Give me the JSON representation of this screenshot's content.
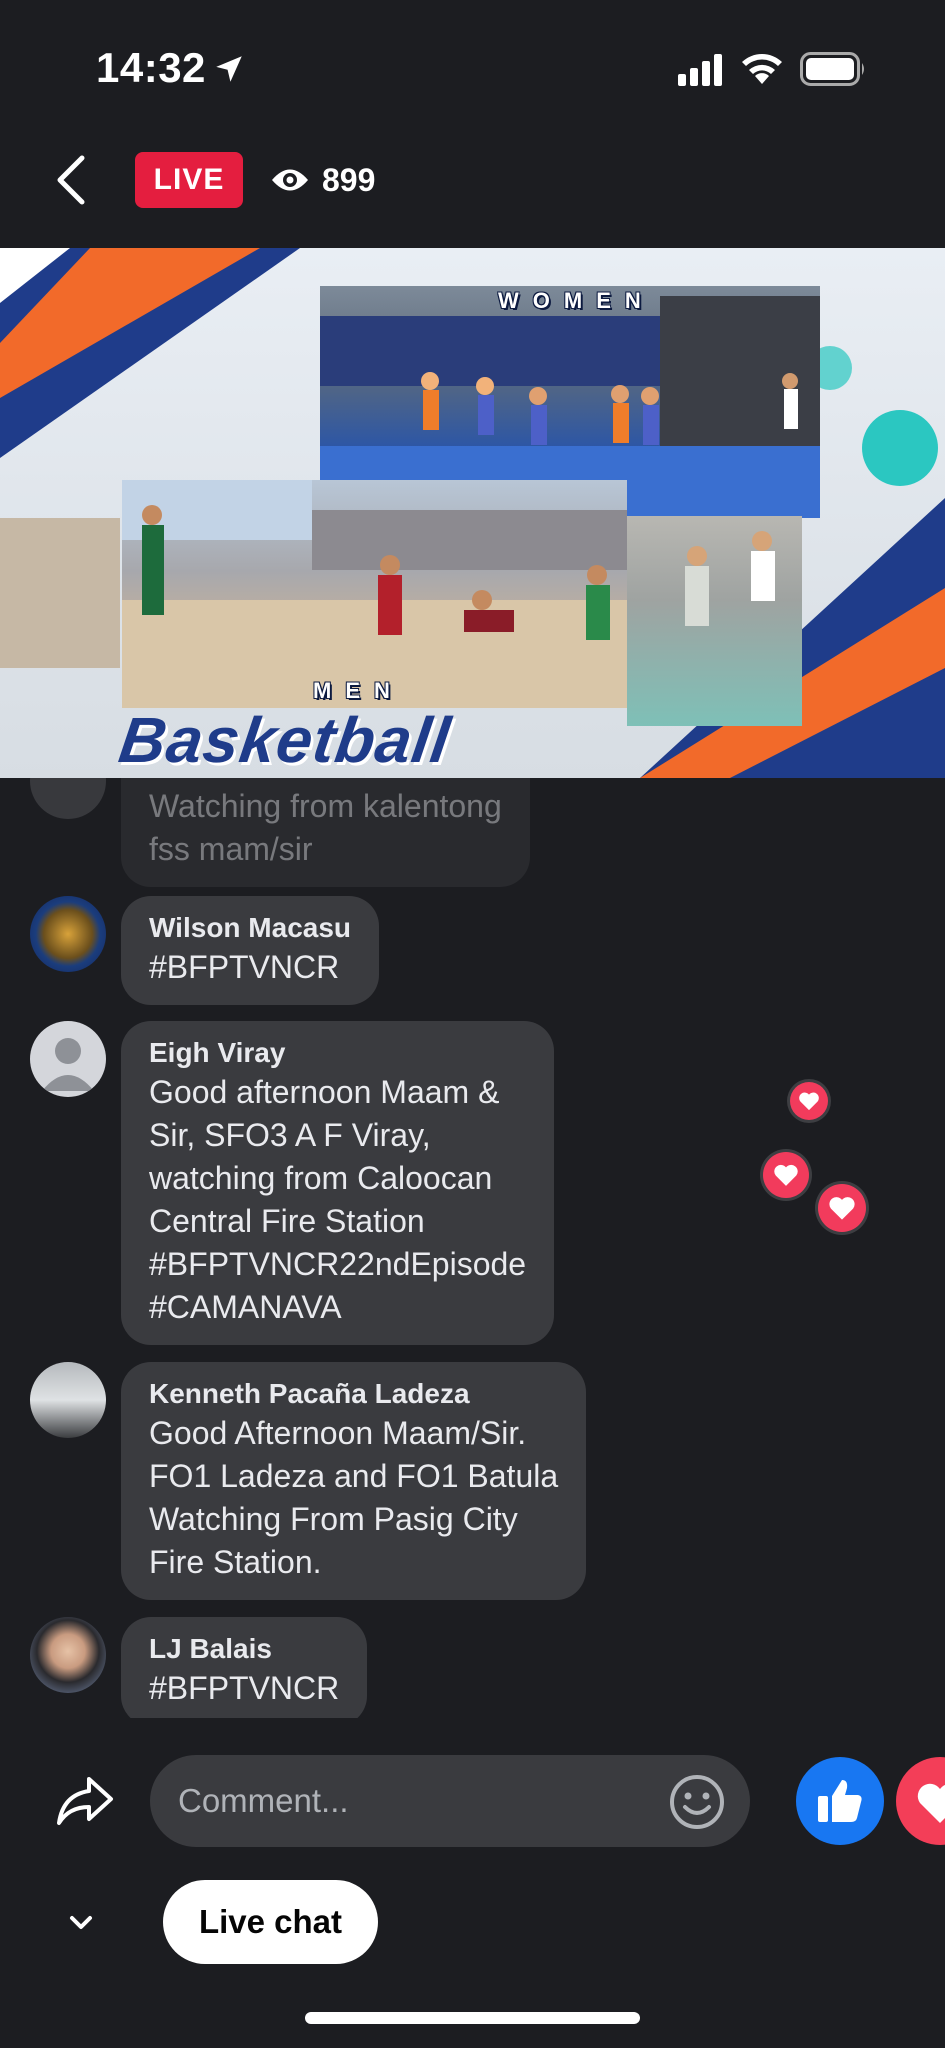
{
  "status_bar": {
    "time": "14:32"
  },
  "header": {
    "live_label": "LIVE",
    "viewer_count": "899"
  },
  "video": {
    "clip_women_label": "WOMEN",
    "clip_men_label": "MEN",
    "title": "Basketball"
  },
  "comments": [
    {
      "name": "",
      "text": "Watching from kalentong\nfss mam/sir"
    },
    {
      "name": "Wilson Macasu",
      "text": "#BFPTVNCR"
    },
    {
      "name": "Eigh Viray",
      "text": "Good afternoon Maam &\nSir, SFO3 A F Viray,\nwatching from Caloocan\nCentral Fire Station\n#BFPTVNCR22ndEpisode\n#CAMANAVA"
    },
    {
      "name": "Kenneth Pacaña Ladeza",
      "text": "Good Afternoon Maam/Sir.\nFO1 Ladeza and FO1 Batula\nWatching From Pasig City\nFire Station."
    },
    {
      "name": "LJ Balais",
      "text": "#BFPTVNCR"
    }
  ],
  "composer": {
    "placeholder": "Comment..."
  },
  "footer": {
    "live_chat_label": "Live chat"
  },
  "colors": {
    "live_red": "#e41e3f",
    "like_blue": "#1877f2",
    "love_pink": "#f33e58",
    "bubble": "#3a3b3f",
    "background": "#1c1d21"
  },
  "icons": [
    "location-arrow-icon",
    "signal-icon",
    "wifi-icon",
    "battery-icon",
    "back-icon",
    "eye-icon",
    "share-icon",
    "emoji-icon",
    "like-icon",
    "love-icon",
    "chevron-down-icon",
    "heart-icon"
  ]
}
